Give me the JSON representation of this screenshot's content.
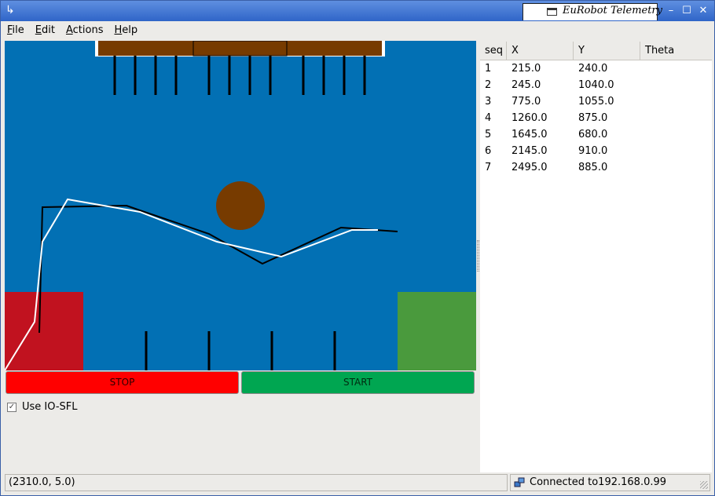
{
  "window": {
    "title": "EuRobot Telemetry",
    "controls": {
      "minimize": "–",
      "maximize": "☐",
      "close": "✕"
    }
  },
  "menu": [
    "File",
    "Edit",
    "Actions",
    "Help"
  ],
  "field": {
    "colors": {
      "background": "#0270b4",
      "top_bar": "#773b00",
      "red_zone": "#c1121f",
      "green_zone": "#4a9a3d",
      "disc": "#773b00",
      "path_black": "#000000",
      "path_white": "#ffffff"
    }
  },
  "buttons": {
    "stop": "STOP",
    "start": "START"
  },
  "checkbox": {
    "label": "Use IO-SFL",
    "checked": true
  },
  "table": {
    "columns": [
      "seq",
      "X",
      "Y",
      "Theta"
    ],
    "rows": [
      [
        "1",
        "215.0",
        "240.0",
        ""
      ],
      [
        "2",
        "245.0",
        "1040.0",
        ""
      ],
      [
        "3",
        "775.0",
        "1055.0",
        ""
      ],
      [
        "4",
        "1260.0",
        "875.0",
        ""
      ],
      [
        "5",
        "1645.0",
        "680.0",
        ""
      ],
      [
        "6",
        "2145.0",
        "910.0",
        ""
      ],
      [
        "7",
        "2495.0",
        "885.0",
        ""
      ]
    ]
  },
  "status": {
    "coords": "(2310.0, 5.0)",
    "connection": "Connected to192.168.0.99"
  }
}
